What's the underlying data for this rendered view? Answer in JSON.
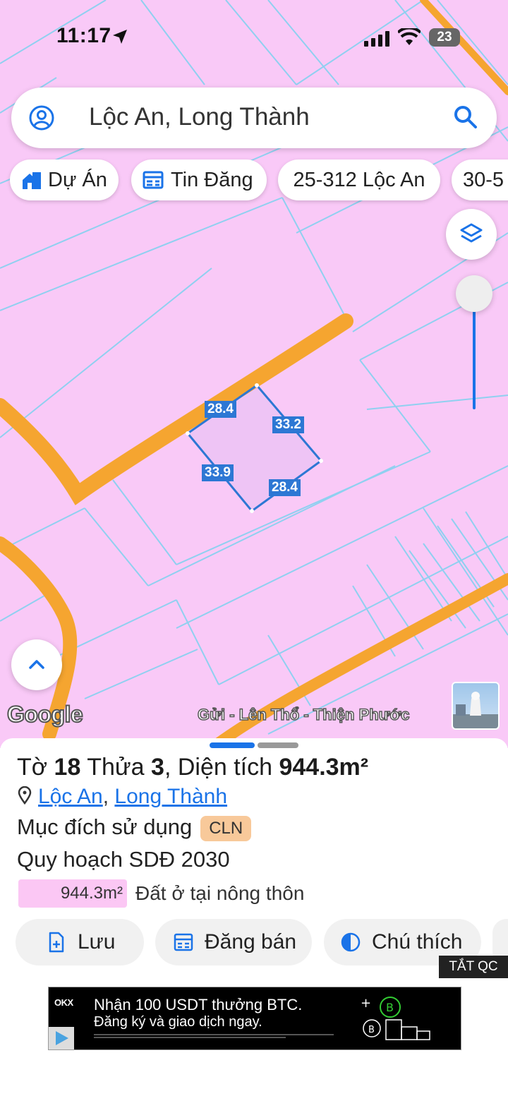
{
  "status": {
    "time": "11:17",
    "battery": "23"
  },
  "search": {
    "text": "Lộc An, Long Thành"
  },
  "chips": [
    {
      "label": "Dự Án",
      "icon": "home-building-icon"
    },
    {
      "label": "Tin Đăng",
      "icon": "listing-icon"
    },
    {
      "label": "25-312 Lộc An",
      "icon": ""
    },
    {
      "label": "30-5",
      "icon": ""
    }
  ],
  "map": {
    "edge_labels": {
      "top": "28.4",
      "right": "33.2",
      "left": "33.9",
      "bottom": "28.4"
    },
    "google_logo": "Google",
    "attribution": "Gửi - Lên Thổ - Thiện Phước",
    "colors": {
      "land": "#f9c9f7",
      "road": "#f5a530",
      "parcel_lines": "#8fd0f0",
      "selection": "#2d77d4"
    }
  },
  "sheet": {
    "title_prefix": "Tờ",
    "sheet_no": "18",
    "thua_label": "Thửa",
    "thua_no": "3",
    "area_label": ", Diện tích",
    "area": "944.3m²",
    "loc_commune": "Lộc An",
    "loc_sep": ", ",
    "loc_district": "Long Thành",
    "purpose_label": "Mục đích sử dụng",
    "purpose_code": "CLN",
    "plan_label": "Quy hoạch SDĐ 2030",
    "legend_area": "944.3m²",
    "legend_text": "Đất ở tại nông thôn",
    "actions": {
      "save": "Lưu",
      "post": "Đăng bán",
      "legend": "Chú thích"
    }
  },
  "ad": {
    "hide_label": "TẮT QC",
    "brand": "OKX",
    "line1": "Nhận 100 USDT thưởng BTC.",
    "line2": "Đăng ký và giao dịch ngay."
  }
}
